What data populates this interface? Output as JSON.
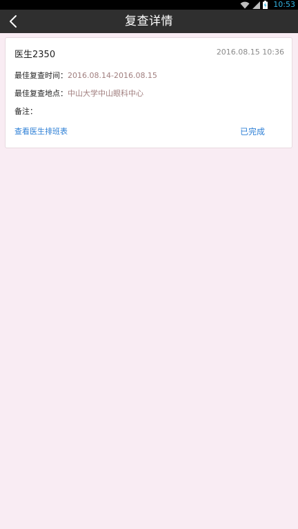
{
  "status_bar": {
    "time": "10:53",
    "time_color": "#33b5e5",
    "icons": [
      "wifi-icon",
      "signal-icon",
      "battery-charging-icon"
    ]
  },
  "nav": {
    "title": "复查详情",
    "back_icon": "chevron-left-icon",
    "background": "#2f2f2f"
  },
  "card": {
    "doctor_name": "医生2350",
    "timestamp": "2016.08.15 10:36",
    "best_time": {
      "label": "最佳复查时间：",
      "value": "2016.08.14-2016.08.15"
    },
    "best_place": {
      "label": "最佳复查地点：",
      "value": "中山大学中山眼科中心"
    },
    "note": {
      "label": "备注：",
      "value": ""
    },
    "schedule_link": "查看医生排班表",
    "status": "已完成"
  },
  "colors": {
    "page_background": "#f9ecf3",
    "accent": "#2d7fd6",
    "value_text": "#a07e7e"
  }
}
